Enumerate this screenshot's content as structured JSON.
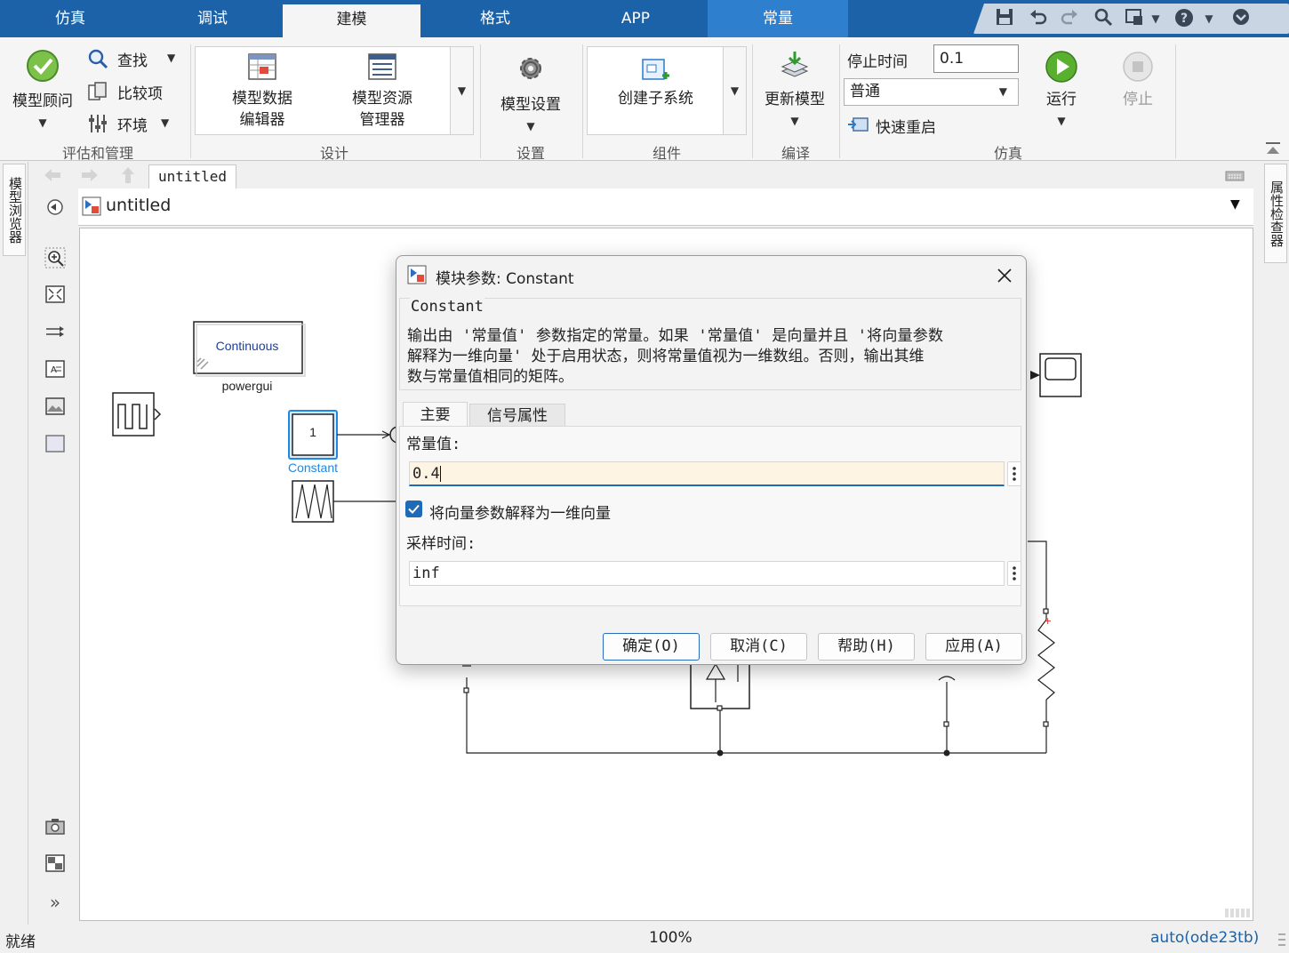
{
  "tabs": [
    {
      "label": "仿真"
    },
    {
      "label": "调试"
    },
    {
      "label": "建模"
    },
    {
      "label": "格式"
    },
    {
      "label": "APP"
    },
    {
      "label": "常量"
    }
  ],
  "active_tab": "建模",
  "ribbon": {
    "model_advisor": "模型顾问",
    "find": "查找",
    "compare": "比较项",
    "environment": "环境",
    "group_eval": "评估和管理",
    "model_data_editor_1": "模型数据",
    "model_data_editor_2": "编辑器",
    "model_explorer_1": "模型资源",
    "model_explorer_2": "管理器",
    "group_design": "设计",
    "model_settings": "模型设置",
    "group_setup": "设置",
    "create_subsystem": "创建子系统",
    "group_component": "组件",
    "update_model": "更新模型",
    "group_compile": "编译",
    "stop_time_label": "停止时间",
    "stop_time_value": "0.1",
    "sim_mode": "普通",
    "fast_restart": "快速重启",
    "run": "运行",
    "stop": "停止",
    "group_sim": "仿真"
  },
  "left_tabs": {
    "model_browser": "模型浏览器"
  },
  "right_tabs": {
    "property_inspector": "属性检查器"
  },
  "nav": {
    "breadcrumb": "untitled"
  },
  "address": {
    "model_name": "untitled"
  },
  "canvas": {
    "powergui_block": "Continuous",
    "powergui_label": "powergui",
    "constant_value": "1",
    "constant_label": "Constant"
  },
  "dialog": {
    "title": "模块参数: Constant",
    "group_name": "Constant",
    "desc_1": "输出由 '常量值' 参数指定的常量。如果 '常量值' 是向量并且 '将向量参数",
    "desc_2": "解释为一维向量' 处于启用状态，则将常量值视为一维数组。否则，输出其维",
    "desc_3": "数与常量值相同的矩阵。",
    "tab_main": "主要",
    "tab_signal": "信号属性",
    "const_label": "常量值:",
    "const_value": "0.4",
    "interpret_checkbox": "将向量参数解释为一维向量",
    "interpret_checked": true,
    "sample_label": "采样时间:",
    "sample_value": "inf",
    "btn_ok": "确定(O)",
    "btn_cancel": "取消(C)",
    "btn_help": "帮助(H)",
    "btn_apply": "应用(A)"
  },
  "status": {
    "left": "就绪",
    "zoom": "100%",
    "solver": "auto(ode23tb)"
  },
  "colors": {
    "tab_bar": "#1b62a8",
    "context_tab": "#2f7fcf",
    "selection": "#1e88e5",
    "solver_text": "#1b62a8"
  }
}
